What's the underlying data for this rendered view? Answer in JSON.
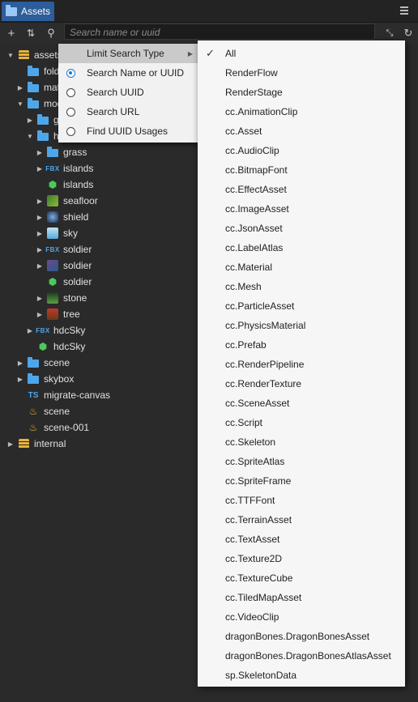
{
  "panel": {
    "tab_label": "Assets"
  },
  "toolbar": {
    "search_placeholder": "Search name or uuid"
  },
  "tree": [
    {
      "label": "assets",
      "indent": 0,
      "expand": "open",
      "icon": "db-icon"
    },
    {
      "label": "folder",
      "indent": 1,
      "expand": "none",
      "icon": "folder-icon"
    },
    {
      "label": "materials",
      "indent": 1,
      "expand": "closed",
      "icon": "folder-icon"
    },
    {
      "label": "models",
      "indent": 1,
      "expand": "open",
      "icon": "folder-icon"
    },
    {
      "label": "grass",
      "indent": 2,
      "expand": "closed",
      "icon": "folder-icon"
    },
    {
      "label": "hero",
      "indent": 2,
      "expand": "open",
      "icon": "folder-icon"
    },
    {
      "label": "grass",
      "indent": 3,
      "expand": "closed",
      "icon": "folder-icon"
    },
    {
      "label": "islands",
      "indent": 3,
      "expand": "closed",
      "icon": "fbx-icon"
    },
    {
      "label": "islands",
      "indent": 3,
      "expand": "none",
      "icon": "mesh-icon"
    },
    {
      "label": "seafloor",
      "indent": 3,
      "expand": "closed",
      "icon": "thumb-seafloor"
    },
    {
      "label": "shield",
      "indent": 3,
      "expand": "closed",
      "icon": "thumb-shield"
    },
    {
      "label": "sky",
      "indent": 3,
      "expand": "closed",
      "icon": "thumb-sky"
    },
    {
      "label": "soldier",
      "indent": 3,
      "expand": "closed",
      "icon": "fbx-icon"
    },
    {
      "label": "soldier",
      "indent": 3,
      "expand": "closed",
      "icon": "thumb-soldier"
    },
    {
      "label": "soldier",
      "indent": 3,
      "expand": "none",
      "icon": "mesh-icon"
    },
    {
      "label": "stone",
      "indent": 3,
      "expand": "closed",
      "icon": "thumb-stone"
    },
    {
      "label": "tree",
      "indent": 3,
      "expand": "closed",
      "icon": "thumb-tree"
    },
    {
      "label": "hdcSky",
      "indent": 2,
      "expand": "closed",
      "icon": "fbx-icon"
    },
    {
      "label": "hdcSky",
      "indent": 2,
      "expand": "none",
      "icon": "mesh-icon"
    },
    {
      "label": "scene",
      "indent": 1,
      "expand": "closed",
      "icon": "folder-icon"
    },
    {
      "label": "skybox",
      "indent": 1,
      "expand": "closed",
      "icon": "folder-icon"
    },
    {
      "label": "migrate-canvas",
      "indent": 1,
      "expand": "none",
      "icon": "ts-icon"
    },
    {
      "label": "scene",
      "indent": 1,
      "expand": "none",
      "icon": "scene-icon"
    },
    {
      "label": "scene-001",
      "indent": 1,
      "expand": "none",
      "icon": "scene-icon"
    },
    {
      "label": "internal",
      "indent": 0,
      "expand": "closed",
      "icon": "db-icon"
    }
  ],
  "menu": [
    {
      "label": "Limit Search Type",
      "kind": "submenu",
      "highlighted": true
    },
    {
      "label": "Search Name or UUID",
      "kind": "radio",
      "checked": true
    },
    {
      "label": "Search UUID",
      "kind": "radio",
      "checked": false
    },
    {
      "label": "Search URL",
      "kind": "radio",
      "checked": false
    },
    {
      "label": "Find UUID Usages",
      "kind": "radio",
      "checked": false
    }
  ],
  "submenu": [
    {
      "label": "All",
      "checked": true
    },
    {
      "label": "RenderFlow"
    },
    {
      "label": "RenderStage"
    },
    {
      "label": "cc.AnimationClip"
    },
    {
      "label": "cc.Asset"
    },
    {
      "label": "cc.AudioClip"
    },
    {
      "label": "cc.BitmapFont"
    },
    {
      "label": "cc.EffectAsset"
    },
    {
      "label": "cc.ImageAsset"
    },
    {
      "label": "cc.JsonAsset"
    },
    {
      "label": "cc.LabelAtlas"
    },
    {
      "label": "cc.Material"
    },
    {
      "label": "cc.Mesh"
    },
    {
      "label": "cc.ParticleAsset"
    },
    {
      "label": "cc.PhysicsMaterial"
    },
    {
      "label": "cc.Prefab"
    },
    {
      "label": "cc.RenderPipeline"
    },
    {
      "label": "cc.RenderTexture"
    },
    {
      "label": "cc.SceneAsset"
    },
    {
      "label": "cc.Script"
    },
    {
      "label": "cc.Skeleton"
    },
    {
      "label": "cc.SpriteAtlas"
    },
    {
      "label": "cc.SpriteFrame"
    },
    {
      "label": "cc.TTFFont"
    },
    {
      "label": "cc.TerrainAsset"
    },
    {
      "label": "cc.TextAsset"
    },
    {
      "label": "cc.Texture2D"
    },
    {
      "label": "cc.TextureCube"
    },
    {
      "label": "cc.TiledMapAsset"
    },
    {
      "label": "cc.VideoClip"
    },
    {
      "label": "dragonBones.DragonBonesAsset"
    },
    {
      "label": "dragonBones.DragonBonesAtlasAsset"
    },
    {
      "label": "sp.SkeletonData"
    }
  ]
}
